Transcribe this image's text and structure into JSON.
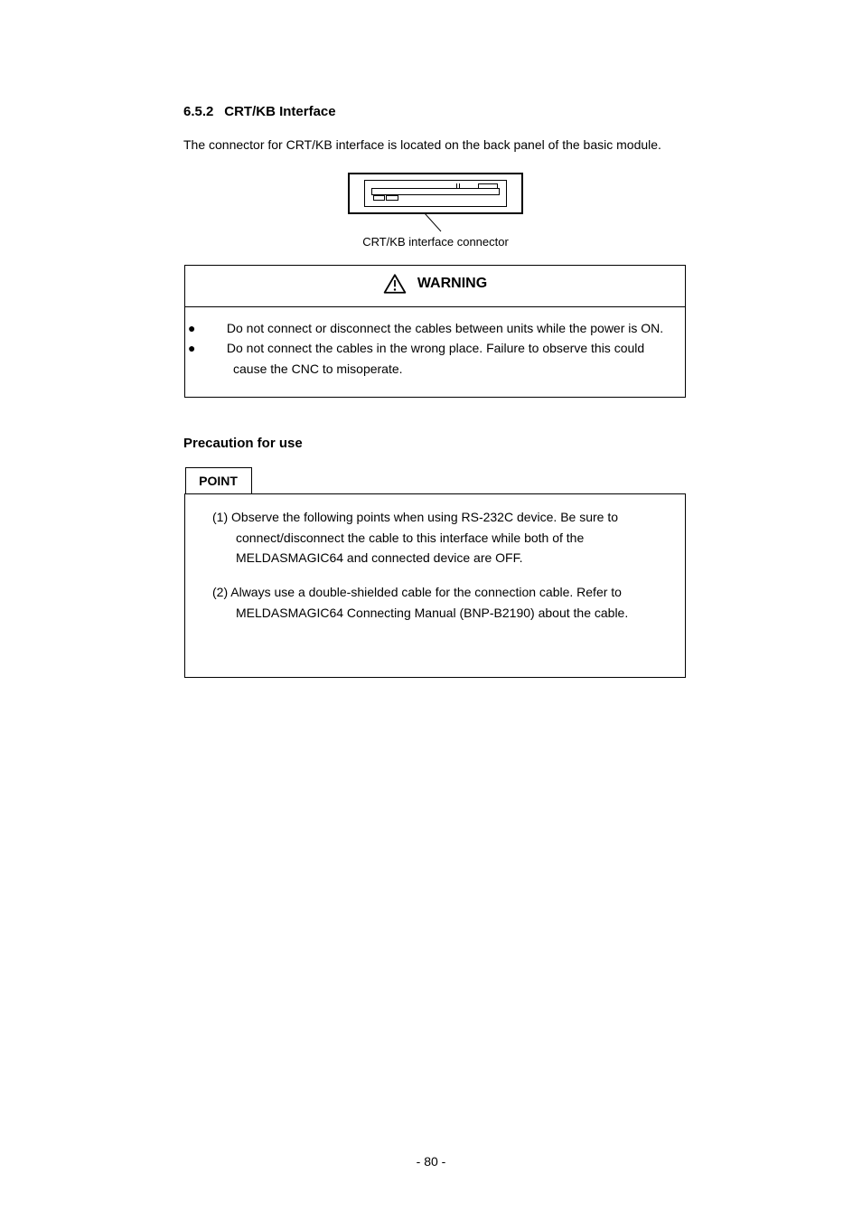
{
  "section": {
    "number": "6.5.2",
    "title": "CRT/KB Interface"
  },
  "intro": "The connector for CRT/KB interface is located on the back panel of the basic module.",
  "figure": {
    "caption_label": "CRT/KB interface connector",
    "pointer_text": ""
  },
  "warning": {
    "heading": "WARNING",
    "line1_bullet": "●",
    "line1": "Do not connect or disconnect the cables between units while the power is ON.",
    "line2_bullet": "●",
    "line2": "Do not connect the cables in the wrong place. Failure to observe this could cause the CNC to misoperate."
  },
  "point": {
    "tab_label": "POINT",
    "item1_bullet": "(1)",
    "item1": "Observe the following points when using RS-232C device. Be sure to connect/disconnect the cable to this interface while both of the MELDASMAGIC64 and connected device are OFF.",
    "item2_bullet": "(2)",
    "item2": "Always use a double-shielded cable for the connection cable. Refer to MELDASMAGIC64 Connecting Manual (BNP-B2190) about the cable."
  },
  "page_footer": "- 80 -"
}
